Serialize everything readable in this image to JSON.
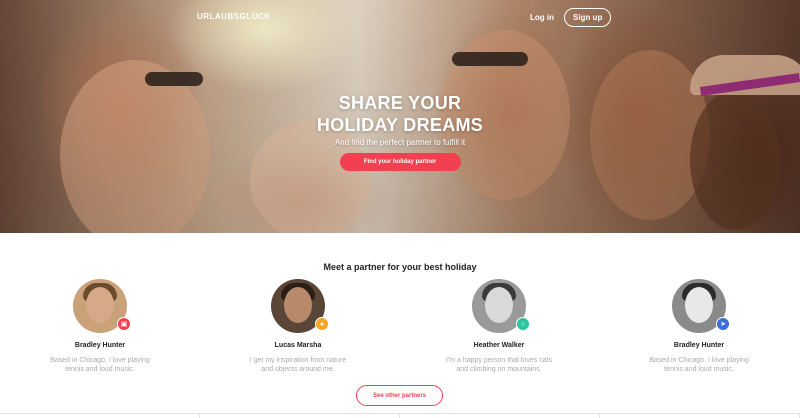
{
  "header": {
    "brand": "URLAUBSGLÜCK",
    "brand_tagline": "",
    "login_label": "Log in",
    "signup_label": "Sign up"
  },
  "hero": {
    "title_line1": "SHARE YOUR",
    "title_line2": "HOLIDAY DREAMS",
    "subtitle": "And find the perfect partner to fulfill it",
    "cta_label": "Find your holiday partner"
  },
  "partners": {
    "heading": "Meet a partner for your best holiday",
    "items": [
      {
        "name": "Bradley Hunter",
        "description": "Based in Chicago. I love playing tennis and loud music.",
        "badge_icon": "camera-icon",
        "badge_color": "#f34050"
      },
      {
        "name": "Lucas Marsha",
        "description": "I get my inspiration from nature and objects around me.",
        "badge_icon": "lock-icon",
        "badge_color": "#f5a623"
      },
      {
        "name": "Heather Walker",
        "description": "I'm a happy person that loves cats and climbing on mountains.",
        "badge_icon": "chat-icon",
        "badge_color": "#2ec4a0"
      },
      {
        "name": "Bradley Hunter",
        "description": "Based in Chicago. I love playing tennis and loud music.",
        "badge_icon": "send-icon",
        "badge_color": "#3b6fd8"
      }
    ],
    "more_label": "See other partners"
  },
  "colors": {
    "accent": "#f34050"
  }
}
